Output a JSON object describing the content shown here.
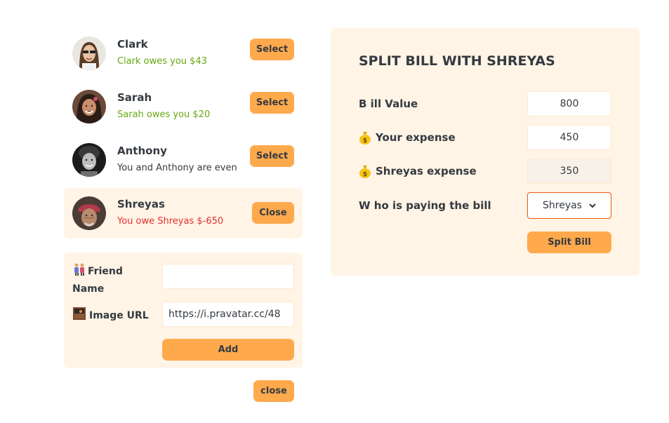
{
  "friends": [
    {
      "name": "Clark",
      "status": "Clark owes you $43",
      "button": "Select"
    },
    {
      "name": "Sarah",
      "status": "Sarah owes you $20",
      "button": "Select"
    },
    {
      "name": "Anthony",
      "status": "You and Anthony are even",
      "button": "Select"
    },
    {
      "name": "Shreyas",
      "status": "You owe Shreyas $-650",
      "button": "Close"
    }
  ],
  "add_form": {
    "friend_name_label": "Friend Name",
    "friend_name_value": "",
    "image_url_label": "Image URL",
    "image_url_value": "https://i.pravatar.cc/48",
    "add_button": "Add"
  },
  "close_button": "close",
  "split": {
    "title": "SPLIT BILL WITH SHREYAS",
    "bill_value_label": "B ill Value",
    "bill_value": "800",
    "your_expense_label": "Your expense",
    "your_expense": "450",
    "friend_expense_label": "Shreyas expense",
    "friend_expense": "350",
    "payer_label": "W ho is paying the bill",
    "payer_selected": "Shreyas",
    "split_button": "Split Bill"
  },
  "colors": {
    "accent": "#ffa94d",
    "panel_bg": "#fff4e6",
    "owes_you": "#66a80f",
    "you_owe": "#e03131"
  }
}
